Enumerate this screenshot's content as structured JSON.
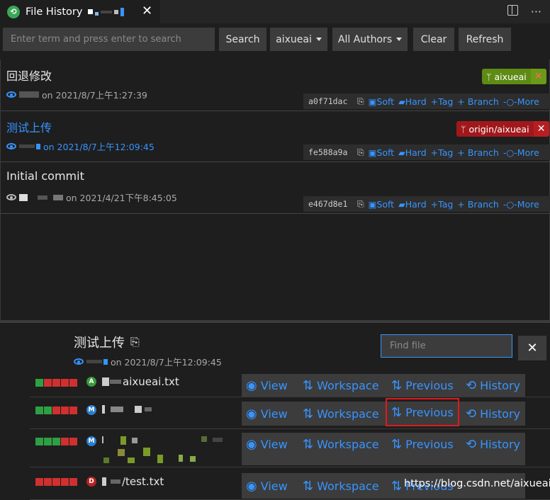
{
  "tab": {
    "title": "File History",
    "icon": "git-history-icon"
  },
  "toolbar": {
    "search_placeholder": "Enter term and press enter to search",
    "search_label": "Search",
    "branch_label": "aixueai",
    "authors_label": "All Authors",
    "clear_label": "Clear",
    "refresh_label": "Refresh"
  },
  "commits": [
    {
      "message": "回退修改",
      "meta": "on 2021/8/7上午1:27:39",
      "hash": "a0f71dac",
      "badge": "aixueai",
      "badge_color": "#5d8b14"
    },
    {
      "message": "测试上传",
      "meta": "on 2021/8/7上午12:09:45",
      "hash": "fe588a9a",
      "badge": "origin/aixueai",
      "badge_color": "#a1181c"
    },
    {
      "message": "Initial commit",
      "meta": "on 2021/4/21下午8:45:05",
      "hash": "e467d8e1"
    }
  ],
  "commit_actions": {
    "soft": "Soft",
    "hard": "Hard",
    "tag": "Tag",
    "branch": "Branch",
    "more": "More"
  },
  "details": {
    "title": "测试上传",
    "meta": "on 2021/8/7上午12:09:45",
    "find_placeholder": "Find file"
  },
  "files": [
    {
      "status": "A",
      "name": "aixueai.txt",
      "status_color": "#3a9a3a"
    },
    {
      "status": "M",
      "name": "",
      "status_color": "#2a7fd0"
    },
    {
      "status": "M",
      "name": "",
      "status_color": "#2a7fd0"
    },
    {
      "status": "D",
      "name": "/test.txt",
      "status_color": "#b52424"
    }
  ],
  "file_actions": {
    "view": "View",
    "workspace": "Workspace",
    "previous": "Previous",
    "history": "History"
  },
  "watermark": "https://blog.csdn.net/aixueai"
}
